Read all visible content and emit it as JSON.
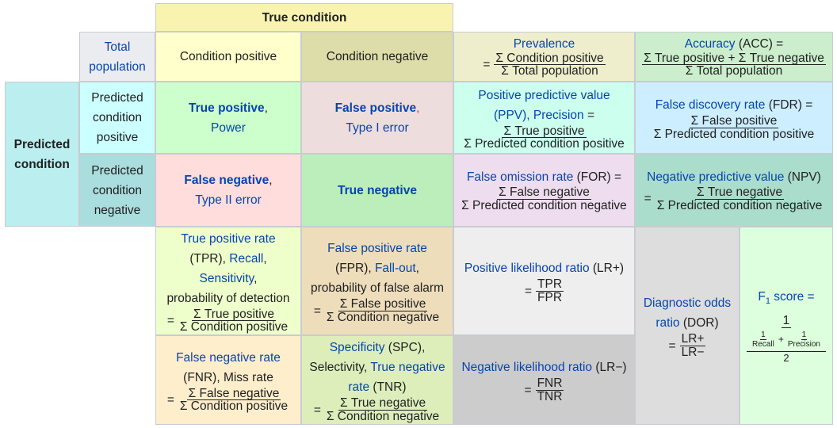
{
  "true_condition": {
    "header": "True condition"
  },
  "total_population": {
    "line1": "Total",
    "line2": "population"
  },
  "condition_positive": "Condition positive",
  "condition_negative": "Condition negative",
  "prevalence": {
    "title": "Prevalence",
    "eq": "=",
    "num": "Σ Condition positive",
    "den": "Σ Total population"
  },
  "accuracy": {
    "title": "Accuracy",
    "abbr": " (ACC) =",
    "num": "Σ True positive + Σ True negative",
    "den": "Σ Total population"
  },
  "predicted_condition": {
    "line1": "Predicted",
    "line2": "condition"
  },
  "predicted_positive": {
    "line1": "Predicted",
    "line2": "condition",
    "line3": "positive"
  },
  "predicted_negative": {
    "line1": "Predicted",
    "line2": "condition",
    "line3": "negative"
  },
  "true_positive": {
    "title": "True positive",
    "comma": ",",
    "sub": "Power"
  },
  "false_positive": {
    "title": "False positive",
    "comma": ",",
    "sub": "Type I error"
  },
  "ppv": {
    "title": "Positive predictive value",
    "line2a": "(PPV), ",
    "precision": "Precision",
    "line2b": " =",
    "num": "Σ True positive",
    "den": "Σ Predicted condition positive"
  },
  "fdr": {
    "title": "False discovery rate",
    "abbr": " (FDR) =",
    "num": "Σ False positive",
    "den": "Σ Predicted condition positive"
  },
  "false_negative": {
    "title": "False negative",
    "comma": ",",
    "sub": "Type II error"
  },
  "true_negative": {
    "title": "True negative"
  },
  "for": {
    "title": "False omission rate",
    "abbr": " (FOR) =",
    "num": "Σ False negative",
    "den": "Σ Predicted condition negative"
  },
  "npv": {
    "title": "Negative predictive value",
    "abbr": " (NPV)",
    "eq": "=",
    "num": "Σ True negative",
    "den": "Σ Predicted condition negative"
  },
  "tpr": {
    "title": "True positive rate",
    "line2a": "(TPR), ",
    "recall": "Recall",
    "recall_comma": ",",
    "sensitivity": "Sensitivity",
    "sens_comma": ",",
    "line4": "probability of detection",
    "eq": "=",
    "num": "Σ True positive",
    "den": "Σ Condition positive"
  },
  "fpr": {
    "title": "False positive rate",
    "line2a": "(FPR), ",
    "fallout": "Fall-out",
    "fall_comma": ",",
    "line3": "probability of false alarm",
    "eq": "=",
    "num": "Σ False positive",
    "den": "Σ Condition negative"
  },
  "lr_pos": {
    "title": "Positive likelihood ratio",
    "abbr": " (LR+)",
    "eq": "=",
    "num": "TPR",
    "den": "FPR"
  },
  "dor": {
    "title1": "Diagnostic odds",
    "title2": "ratio",
    "abbr": " (DOR)",
    "eq": "=",
    "num": "LR+",
    "den": "LR−"
  },
  "f1": {
    "f": "F",
    "sub": "1",
    "label": " score =",
    "num": "1",
    "r_num": "1",
    "r_den": "Recall",
    "plus": "+",
    "p_num": "1",
    "p_den": "Precision",
    "den": "2"
  },
  "fnr": {
    "title": "False negative rate",
    "line2": "(FNR), Miss rate",
    "eq": "=",
    "num": "Σ False negative",
    "den": "Σ Condition positive"
  },
  "spc": {
    "title": "Specificity",
    "abbr": " (SPC),",
    "selectivity": "Selectivity, ",
    "tn_rate": "True negative",
    "rate": "rate",
    "abbr2": " (TNR)",
    "eq": "=",
    "num": "Σ True negative",
    "den": "Σ Condition negative"
  },
  "lr_neg": {
    "title": "Negative likelihood ratio",
    "abbr": " (LR−)",
    "eq": "=",
    "num": "FNR",
    "den": "TNR"
  },
  "colors": {
    "link": "#0645ad",
    "header": "#f8f4b0",
    "cond_pos": "#ffffcc",
    "cond_neg": "#dddda9",
    "tp": "#ccffcc",
    "fp": "#eedddd",
    "fn": "#ffdddd",
    "tn": "#bbeebb",
    "predicted": "#bbeeee"
  }
}
